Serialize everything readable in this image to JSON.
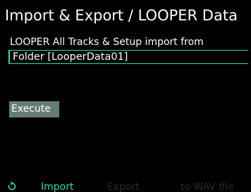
{
  "header": {
    "title": "Import & Export / LOOPER Data"
  },
  "main": {
    "description": "LOOPER All Tracks & Setup import from",
    "source_value": "Folder [LooperData01]",
    "execute_label": "Execute"
  },
  "footer": {
    "knob_icon": "rotate-knob-icon",
    "tabs": [
      {
        "label": "Import",
        "active": true
      },
      {
        "label": "Export",
        "active": false
      },
      {
        "label": "to WAV file",
        "active": false
      }
    ]
  },
  "colors": {
    "accent": "#39d6b3",
    "button_bg": "#657d76",
    "inactive_tab": "#2a2a2a",
    "background": "#000000"
  }
}
